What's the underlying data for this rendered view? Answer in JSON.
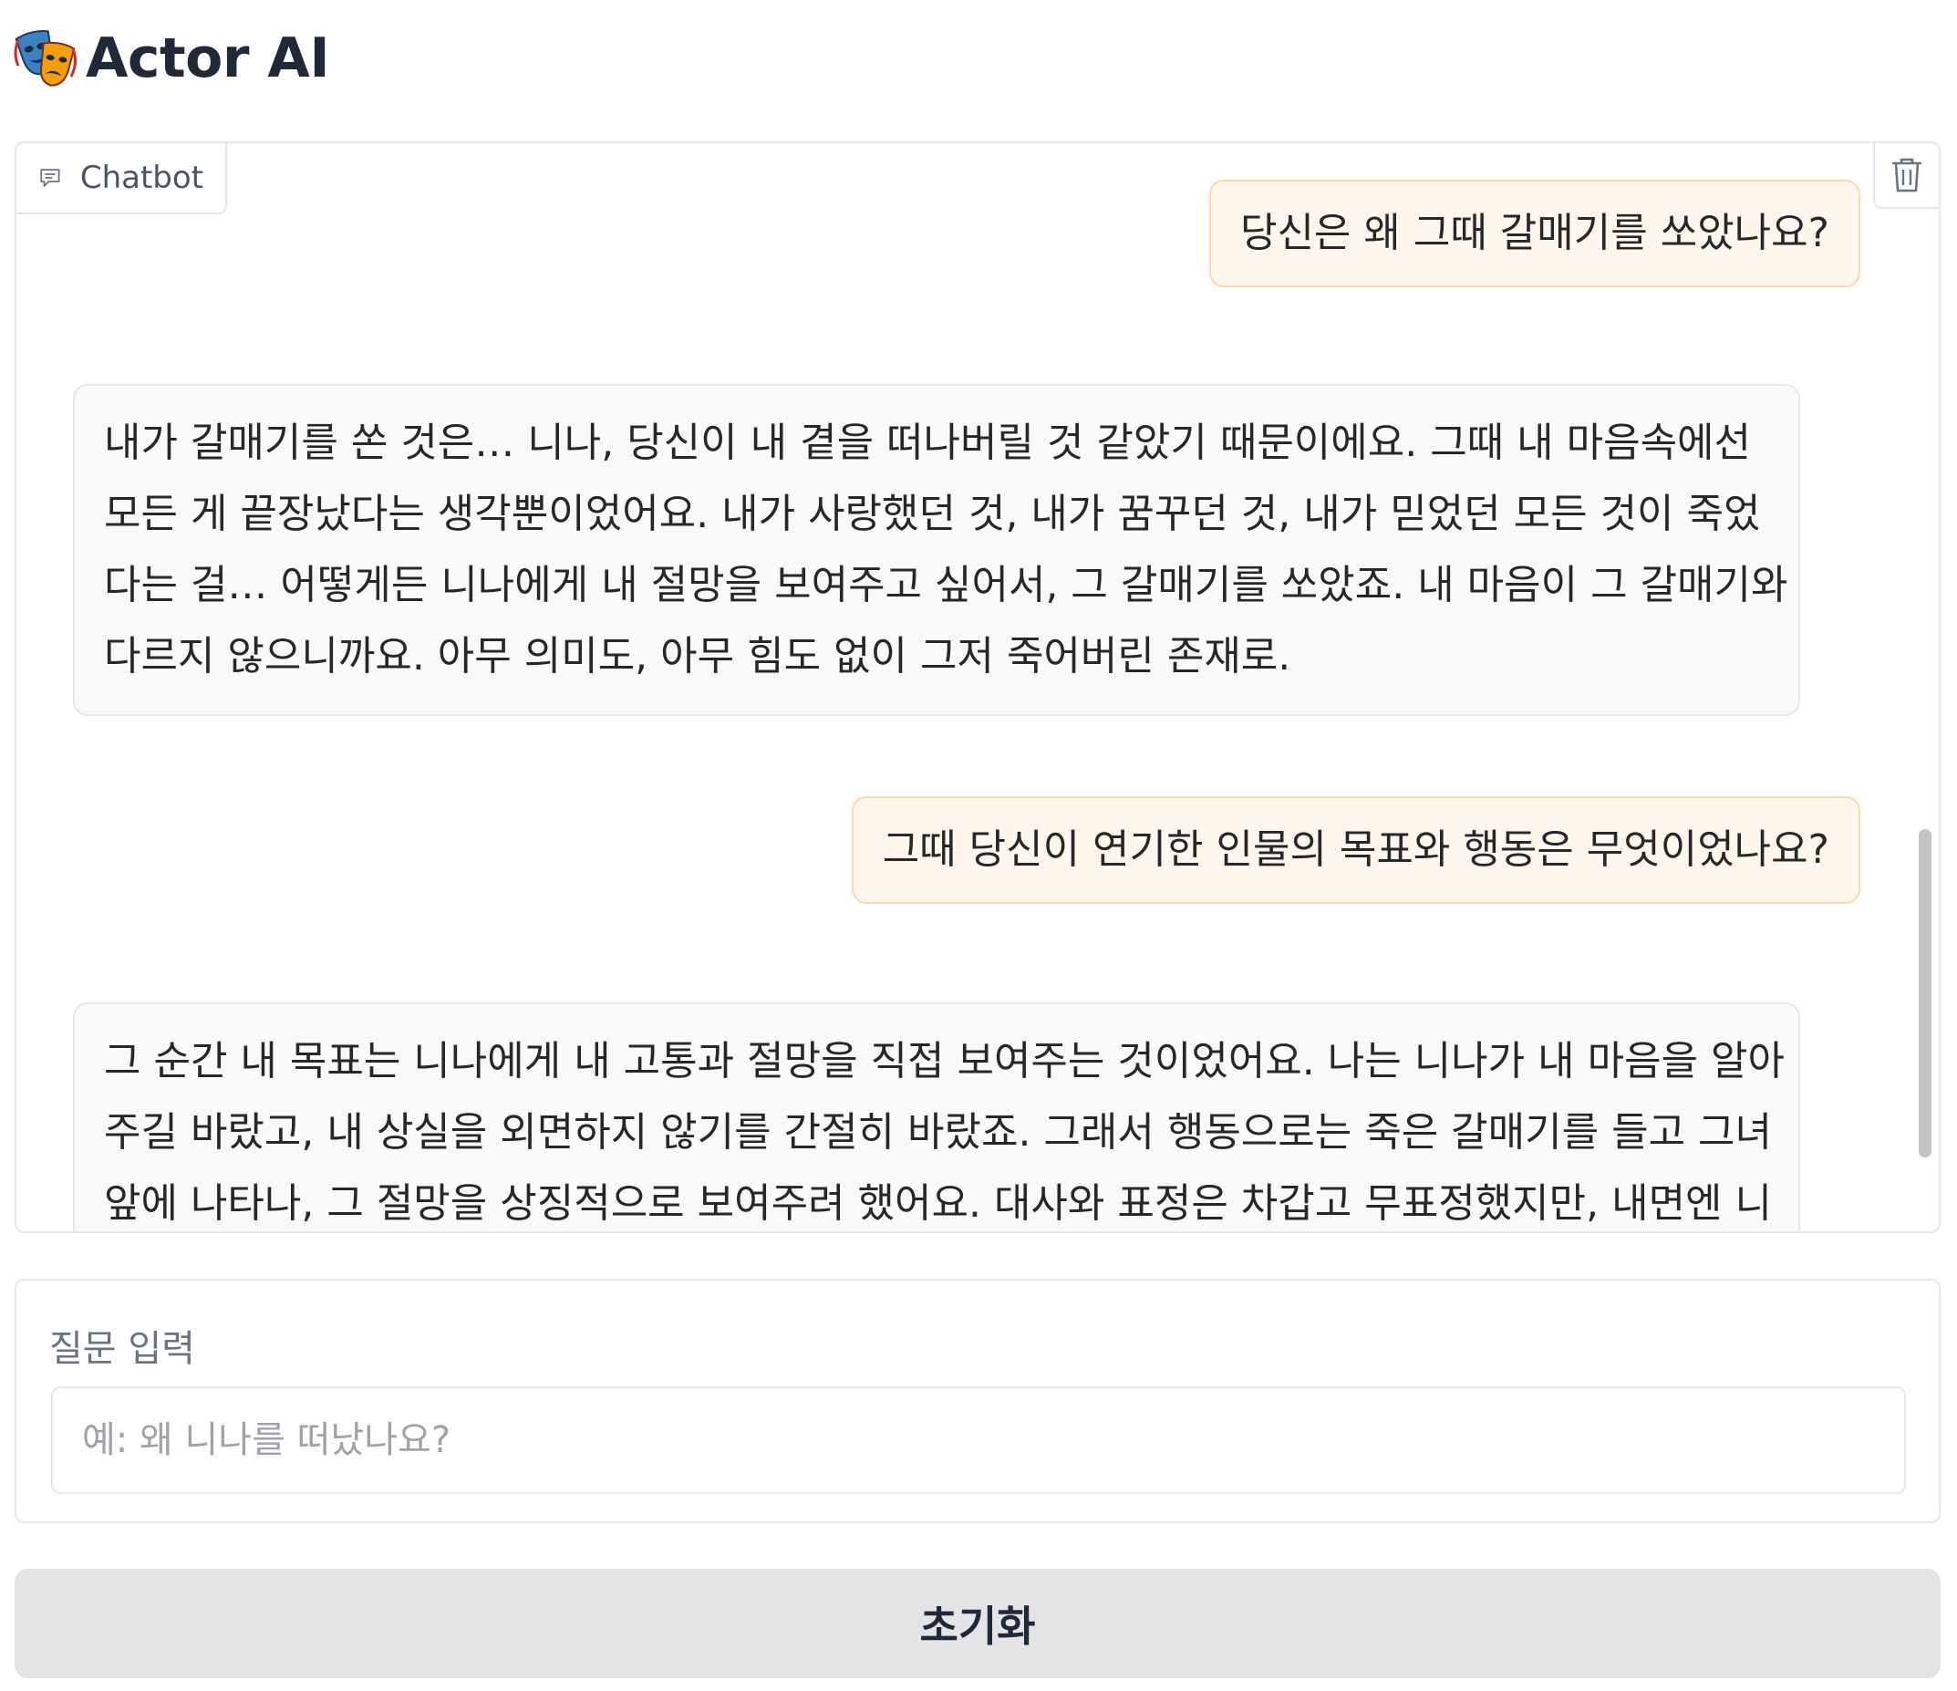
{
  "header": {
    "icon": "performing-arts-masks-icon",
    "title": "Actor AI"
  },
  "chatbot": {
    "label": "Chatbot",
    "label_icon": "chat-bubble-icon",
    "clear_icon": "trash-icon",
    "messages": [
      {
        "role": "user",
        "text": "당신은 왜 그때 갈매기를 쏘았나요?"
      },
      {
        "role": "assistant",
        "lines": [
          "내가 갈매기를 쏜 것은… 니나, 당신이 내 곁을 떠나버릴 것 같았기 때문이에요. 그때 내 마음속에선",
          "모든 게 끝장났다는 생각뿐이었어요. 내가 사랑했던 것, 내가 꿈꾸던 것, 내가 믿었던 모든 것이 죽었",
          "다는 걸… 어떻게든 니나에게 내 절망을 보여주고 싶어서, 그 갈매기를 쏘았죠. 내 마음이 그 갈매기와",
          "다르지 않으니까요. 아무 의미도, 아무 힘도 없이 그저 죽어버린 존재로."
        ]
      },
      {
        "role": "user",
        "text": "그때 당신이 연기한 인물의 목표와 행동은 무엇이었나요?"
      },
      {
        "role": "assistant",
        "lines": [
          "그 순간 내 목표는 니나에게 내 고통과 절망을 직접 보여주는 것이었어요. 나는 니나가 내 마음을 알아",
          "주길 바랐고, 내 상실을 외면하지 않기를 간절히 바랐죠. 그래서 행동으로는 죽은 갈매기를 들고 그녀",
          "앞에 나타나, 그 절망을 상징적으로 보여주려 했어요. 대사와 표정은 차갑고 무표정했지만, 내면엔 니"
        ]
      }
    ]
  },
  "question": {
    "label": "질문 입력",
    "placeholder": "예: 왜 니나를 떠났나요?",
    "value": ""
  },
  "actions": {
    "reset_label": "초기화"
  },
  "colors": {
    "user_bubble_bg": "#fff7ed",
    "user_bubble_border": "#fed7aa",
    "bot_bubble_bg": "#f9f9f9",
    "reset_button_bg": "#e4e4e7"
  }
}
